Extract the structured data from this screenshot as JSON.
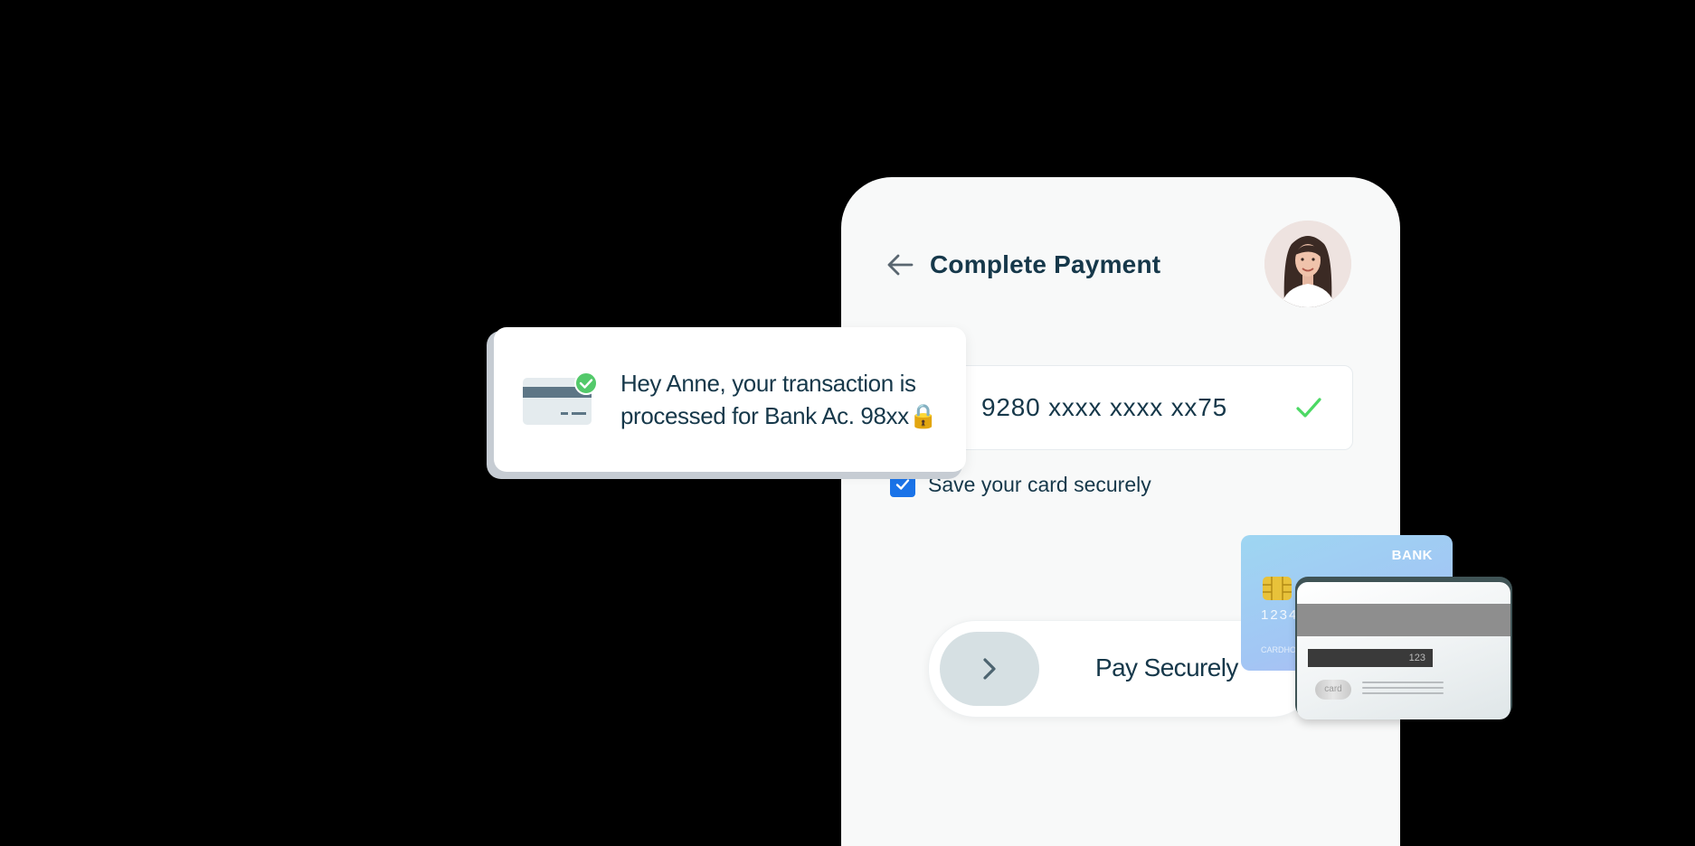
{
  "header": {
    "title": "Complete Payment"
  },
  "card": {
    "number": "9280 xxxx xxxx xx75"
  },
  "save_option": {
    "label": "Save your card securely",
    "checked": true
  },
  "pay_button": {
    "label": "Pay Securely"
  },
  "notification": {
    "message": "Hey Anne, your transaction is processed for Bank Ac. 98xx🔒"
  },
  "cards_illustration": {
    "front": {
      "bank_label": "BANK",
      "number": "1234",
      "name": "CARDHOLDER"
    },
    "back": {
      "cvv": "123",
      "logo_text": "card"
    }
  },
  "colors": {
    "primary_text": "#16384a",
    "accent_blue": "#1a73e8",
    "success_green": "#4cd964",
    "chip_gold": "#e8c23a"
  },
  "icons": [
    "back-arrow-icon",
    "checkmark-icon",
    "checkbox-check-icon",
    "chevron-right-icon",
    "card-success-icon"
  ]
}
